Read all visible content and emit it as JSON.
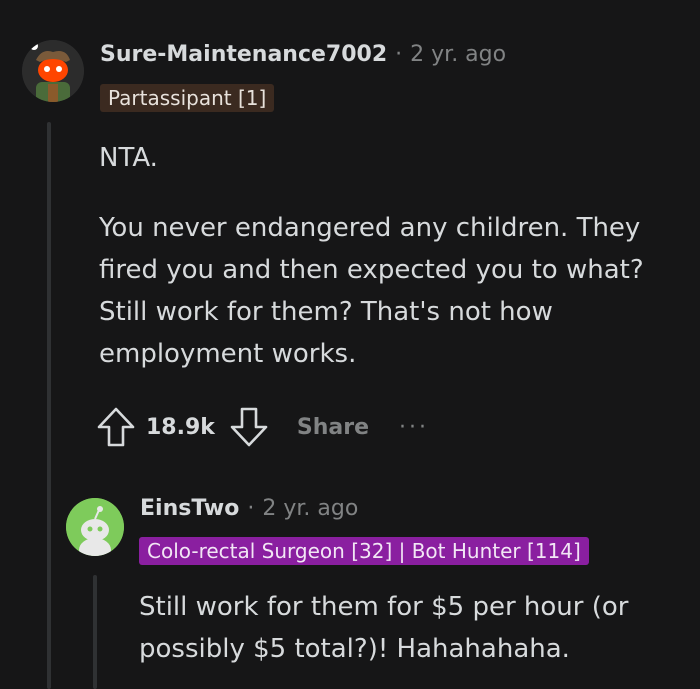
{
  "comment1": {
    "username": "Sure-Maintenance7002",
    "separator": "·",
    "age": "2 yr. ago",
    "flair": "Partassipant [1]",
    "flair_bg": "#3b2a20",
    "paragraphs": [
      "NTA.",
      "You never endangered any children. They fired you and then expected you to what? Still work for them? That's not how employment works."
    ],
    "votes": "18.9k",
    "share_label": "Share",
    "more_label": "···",
    "avatar_icon": "snoo-avatar-icon"
  },
  "comment2": {
    "username": "EinsTwo",
    "separator": "·",
    "age": "2 yr. ago",
    "flair": "Colo-rectal Surgeon [32] | Bot Hunter [114]",
    "flair_bg": "#8a1fa0",
    "paragraphs": [
      "Still work for them for $5 per hour (or possibly $5 total?)! Hahahahaha."
    ],
    "avatar_icon": "snoo-avatar-icon"
  },
  "colors": {
    "background": "#161617",
    "text": "#d7dadc",
    "muted": "#818384",
    "thread_line": "#2f3133",
    "avatar2_bg": "#7ecb5b"
  }
}
